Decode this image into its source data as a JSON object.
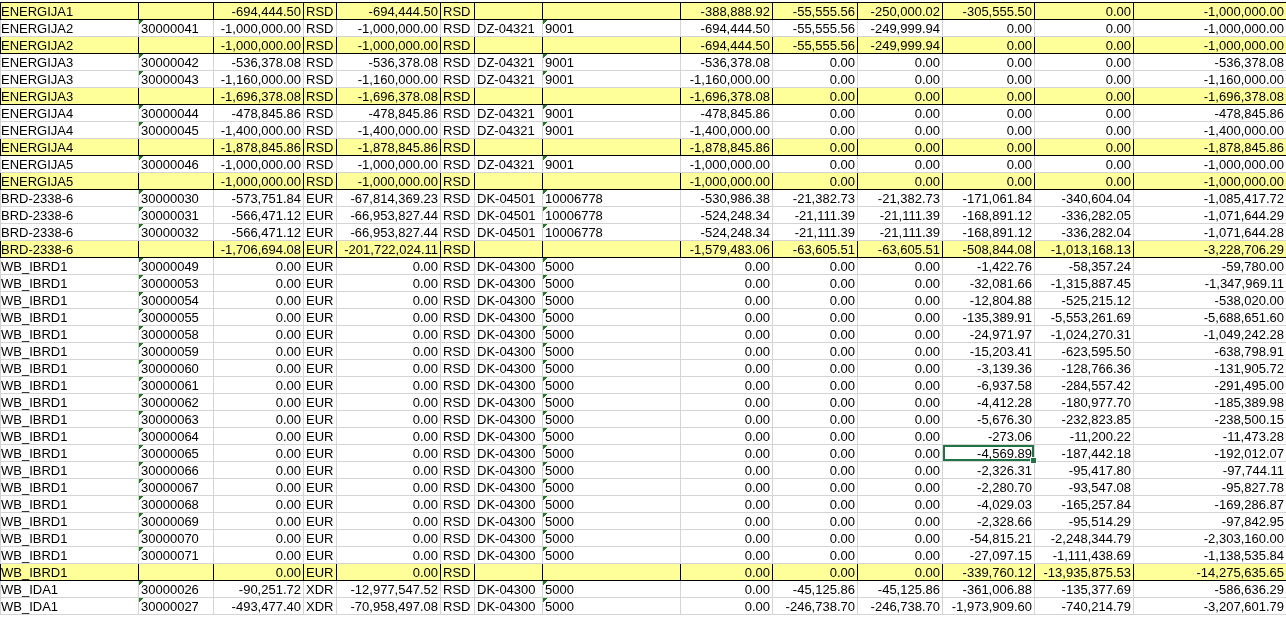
{
  "sheet": {
    "rows": [
      {
        "kind": "total",
        "cells": [
          "ENERGIJA1",
          null,
          "-694,444.50",
          "RSD",
          "-694,444.50",
          "RSD",
          null,
          null,
          "-388,888.92",
          "-55,555.56",
          "-250,000.02",
          "-305,555.50",
          "0.00",
          "-1,000,000.00"
        ]
      },
      {
        "kind": "item",
        "cells": [
          "ENERGIJA2",
          "30000041",
          "-1,000,000.00",
          "RSD",
          "-1,000,000.00",
          "RSD",
          "DZ-04321",
          "9001",
          "-694,444.50",
          "-55,555.56",
          "-249,999.94",
          "0.00",
          "0.00",
          "-1,000,000.00"
        ]
      },
      {
        "kind": "total",
        "cells": [
          "ENERGIJA2",
          null,
          "-1,000,000.00",
          "RSD",
          "-1,000,000.00",
          "RSD",
          null,
          null,
          "-694,444.50",
          "-55,555.56",
          "-249,999.94",
          "0.00",
          "0.00",
          "-1,000,000.00"
        ]
      },
      {
        "kind": "item",
        "cells": [
          "ENERGIJA3",
          "30000042",
          "-536,378.08",
          "RSD",
          "-536,378.08",
          "RSD",
          "DZ-04321",
          "9001",
          "-536,378.08",
          "0.00",
          "0.00",
          "0.00",
          "0.00",
          "-536,378.08"
        ]
      },
      {
        "kind": "item",
        "cells": [
          "ENERGIJA3",
          "30000043",
          "-1,160,000.00",
          "RSD",
          "-1,160,000.00",
          "RSD",
          "DZ-04321",
          "9001",
          "-1,160,000.00",
          "0.00",
          "0.00",
          "0.00",
          "0.00",
          "-1,160,000.00"
        ]
      },
      {
        "kind": "total",
        "cells": [
          "ENERGIJA3",
          null,
          "-1,696,378.08",
          "RSD",
          "-1,696,378.08",
          "RSD",
          null,
          null,
          "-1,696,378.08",
          "0.00",
          "0.00",
          "0.00",
          "0.00",
          "-1,696,378.08"
        ]
      },
      {
        "kind": "item",
        "cells": [
          "ENERGIJA4",
          "30000044",
          "-478,845.86",
          "RSD",
          "-478,845.86",
          "RSD",
          "DZ-04321",
          "9001",
          "-478,845.86",
          "0.00",
          "0.00",
          "0.00",
          "0.00",
          "-478,845.86"
        ]
      },
      {
        "kind": "item",
        "cells": [
          "ENERGIJA4",
          "30000045",
          "-1,400,000.00",
          "RSD",
          "-1,400,000.00",
          "RSD",
          "DZ-04321",
          "9001",
          "-1,400,000.00",
          "0.00",
          "0.00",
          "0.00",
          "0.00",
          "-1,400,000.00"
        ]
      },
      {
        "kind": "total",
        "cells": [
          "ENERGIJA4",
          null,
          "-1,878,845.86",
          "RSD",
          "-1,878,845.86",
          "RSD",
          null,
          null,
          "-1,878,845.86",
          "0.00",
          "0.00",
          "0.00",
          "0.00",
          "-1,878,845.86"
        ]
      },
      {
        "kind": "item",
        "cells": [
          "ENERGIJA5",
          "30000046",
          "-1,000,000.00",
          "RSD",
          "-1,000,000.00",
          "RSD",
          "DZ-04321",
          "9001",
          "-1,000,000.00",
          "0.00",
          "0.00",
          "0.00",
          "0.00",
          "-1,000,000.00"
        ]
      },
      {
        "kind": "total",
        "cells": [
          "ENERGIJA5",
          null,
          "-1,000,000.00",
          "RSD",
          "-1,000,000.00",
          "RSD",
          null,
          null,
          "-1,000,000.00",
          "0.00",
          "0.00",
          "0.00",
          "0.00",
          "-1,000,000.00"
        ]
      },
      {
        "kind": "item",
        "cells": [
          "BRD-2338-6",
          "30000030",
          "-573,751.84",
          "EUR",
          "-67,814,369.23",
          "RSD",
          "DK-04501",
          "10006778",
          "-530,986.38",
          "-21,382.73",
          "-21,382.73",
          "-171,061.84",
          "-340,604.04",
          "-1,085,417.72"
        ]
      },
      {
        "kind": "item",
        "cells": [
          "BRD-2338-6",
          "30000031",
          "-566,471.12",
          "EUR",
          "-66,953,827.44",
          "RSD",
          "DK-04501",
          "10006778",
          "-524,248.34",
          "-21,111.39",
          "-21,111.39",
          "-168,891.12",
          "-336,282.05",
          "-1,071,644.29"
        ]
      },
      {
        "kind": "item",
        "cells": [
          "BRD-2338-6",
          "30000032",
          "-566,471.12",
          "EUR",
          "-66,953,827.44",
          "RSD",
          "DK-04501",
          "10006778",
          "-524,248.34",
          "-21,111.39",
          "-21,111.39",
          "-168,891.12",
          "-336,282.04",
          "-1,071,644.28"
        ]
      },
      {
        "kind": "total",
        "cells": [
          "BRD-2338-6",
          null,
          "-1,706,694.08",
          "EUR",
          "-201,722,024.11",
          "RSD",
          null,
          null,
          "-1,579,483.06",
          "-63,605.51",
          "-63,605.51",
          "-508,844.08",
          "-1,013,168.13",
          "-3,228,706.29"
        ]
      },
      {
        "kind": "item",
        "cells": [
          "WB_IBRD1",
          "30000049",
          "0.00",
          "EUR",
          "0.00",
          "RSD",
          "DK-04300",
          "5000",
          "0.00",
          "0.00",
          "0.00",
          "-1,422.76",
          "-58,357.24",
          "-59,780.00"
        ]
      },
      {
        "kind": "item",
        "cells": [
          "WB_IBRD1",
          "30000053",
          "0.00",
          "EUR",
          "0.00",
          "RSD",
          "DK-04300",
          "5000",
          "0.00",
          "0.00",
          "0.00",
          "-32,081.66",
          "-1,315,887.45",
          "-1,347,969.11"
        ]
      },
      {
        "kind": "item",
        "cells": [
          "WB_IBRD1",
          "30000054",
          "0.00",
          "EUR",
          "0.00",
          "RSD",
          "DK-04300",
          "5000",
          "0.00",
          "0.00",
          "0.00",
          "-12,804.88",
          "-525,215.12",
          "-538,020.00"
        ]
      },
      {
        "kind": "item",
        "cells": [
          "WB_IBRD1",
          "30000055",
          "0.00",
          "EUR",
          "0.00",
          "RSD",
          "DK-04300",
          "5000",
          "0.00",
          "0.00",
          "0.00",
          "-135,389.91",
          "-5,553,261.69",
          "-5,688,651.60"
        ]
      },
      {
        "kind": "item",
        "cells": [
          "WB_IBRD1",
          "30000058",
          "0.00",
          "EUR",
          "0.00",
          "RSD",
          "DK-04300",
          "5000",
          "0.00",
          "0.00",
          "0.00",
          "-24,971.97",
          "-1,024,270.31",
          "-1,049,242.28"
        ]
      },
      {
        "kind": "item",
        "cells": [
          "WB_IBRD1",
          "30000059",
          "0.00",
          "EUR",
          "0.00",
          "RSD",
          "DK-04300",
          "5000",
          "0.00",
          "0.00",
          "0.00",
          "-15,203.41",
          "-623,595.50",
          "-638,798.91"
        ]
      },
      {
        "kind": "item",
        "cells": [
          "WB_IBRD1",
          "30000060",
          "0.00",
          "EUR",
          "0.00",
          "RSD",
          "DK-04300",
          "5000",
          "0.00",
          "0.00",
          "0.00",
          "-3,139.36",
          "-128,766.36",
          "-131,905.72"
        ]
      },
      {
        "kind": "item",
        "cells": [
          "WB_IBRD1",
          "30000061",
          "0.00",
          "EUR",
          "0.00",
          "RSD",
          "DK-04300",
          "5000",
          "0.00",
          "0.00",
          "0.00",
          "-6,937.58",
          "-284,557.42",
          "-291,495.00"
        ]
      },
      {
        "kind": "item",
        "cells": [
          "WB_IBRD1",
          "30000062",
          "0.00",
          "EUR",
          "0.00",
          "RSD",
          "DK-04300",
          "5000",
          "0.00",
          "0.00",
          "0.00",
          "-4,412.28",
          "-180,977.70",
          "-185,389.98"
        ]
      },
      {
        "kind": "item",
        "cells": [
          "WB_IBRD1",
          "30000063",
          "0.00",
          "EUR",
          "0.00",
          "RSD",
          "DK-04300",
          "5000",
          "0.00",
          "0.00",
          "0.00",
          "-5,676.30",
          "-232,823.85",
          "-238,500.15"
        ]
      },
      {
        "kind": "item",
        "cells": [
          "WB_IBRD1",
          "30000064",
          "0.00",
          "EUR",
          "0.00",
          "RSD",
          "DK-04300",
          "5000",
          "0.00",
          "0.00",
          "0.00",
          "-273.06",
          "-11,200.22",
          "-11,473.28"
        ]
      },
      {
        "kind": "item",
        "cells": [
          "WB_IBRD1",
          "30000065",
          "0.00",
          "EUR",
          "0.00",
          "RSD",
          "DK-04300",
          "5000",
          "0.00",
          "0.00",
          "0.00",
          {
            "text": "-4,569.89",
            "selected": true
          },
          "-187,442.18",
          "-192,012.07"
        ]
      },
      {
        "kind": "item",
        "cells": [
          "WB_IBRD1",
          "30000066",
          "0.00",
          "EUR",
          "0.00",
          "RSD",
          "DK-04300",
          "5000",
          "0.00",
          "0.00",
          "0.00",
          "-2,326.31",
          "-95,417.80",
          "-97,744.11"
        ]
      },
      {
        "kind": "item",
        "cells": [
          "WB_IBRD1",
          "30000067",
          "0.00",
          "EUR",
          "0.00",
          "RSD",
          "DK-04300",
          "5000",
          "0.00",
          "0.00",
          "0.00",
          "-2,280.70",
          "-93,547.08",
          "-95,827.78"
        ]
      },
      {
        "kind": "item",
        "cells": [
          "WB_IBRD1",
          "30000068",
          "0.00",
          "EUR",
          "0.00",
          "RSD",
          "DK-04300",
          "5000",
          "0.00",
          "0.00",
          "0.00",
          "-4,029.03",
          "-165,257.84",
          "-169,286.87"
        ]
      },
      {
        "kind": "item",
        "cells": [
          "WB_IBRD1",
          "30000069",
          "0.00",
          "EUR",
          "0.00",
          "RSD",
          "DK-04300",
          "5000",
          "0.00",
          "0.00",
          "0.00",
          "-2,328.66",
          "-95,514.29",
          "-97,842.95"
        ]
      },
      {
        "kind": "item",
        "cells": [
          "WB_IBRD1",
          "30000070",
          "0.00",
          "EUR",
          "0.00",
          "RSD",
          "DK-04300",
          "5000",
          "0.00",
          "0.00",
          "0.00",
          "-54,815.21",
          "-2,248,344.79",
          "-2,303,160.00"
        ]
      },
      {
        "kind": "item",
        "cells": [
          "WB_IBRD1",
          "30000071",
          "0.00",
          "EUR",
          "0.00",
          "RSD",
          "DK-04300",
          "5000",
          "0.00",
          "0.00",
          "0.00",
          "-27,097.15",
          "-1,111,438.69",
          "-1,138,535.84"
        ]
      },
      {
        "kind": "total",
        "cells": [
          "WB_IBRD1",
          null,
          "0.00",
          "EUR",
          "0.00",
          "RSD",
          null,
          null,
          "0.00",
          "0.00",
          "0.00",
          "-339,760.12",
          "-13,935,875.53",
          "-14,275,635.65"
        ]
      },
      {
        "kind": "item",
        "cells": [
          "WB_IDA1",
          "30000026",
          "-90,251.72",
          "XDR",
          "-12,977,547.52",
          "RSD",
          "DK-04300",
          "5000",
          "0.00",
          "-45,125.86",
          "-45,125.86",
          "-361,006.88",
          "-135,377.69",
          "-586,636.29"
        ]
      },
      {
        "kind": "item",
        "cells": [
          "WB_IDA1",
          "30000027",
          "-493,477.40",
          "XDR",
          "-70,958,497.08",
          "RSD",
          "DK-04300",
          "5000",
          "0.00",
          "-246,738.70",
          "-246,738.70",
          "-1,973,909.60",
          "-740,214.79",
          "-3,207,601.79"
        ]
      }
    ]
  }
}
